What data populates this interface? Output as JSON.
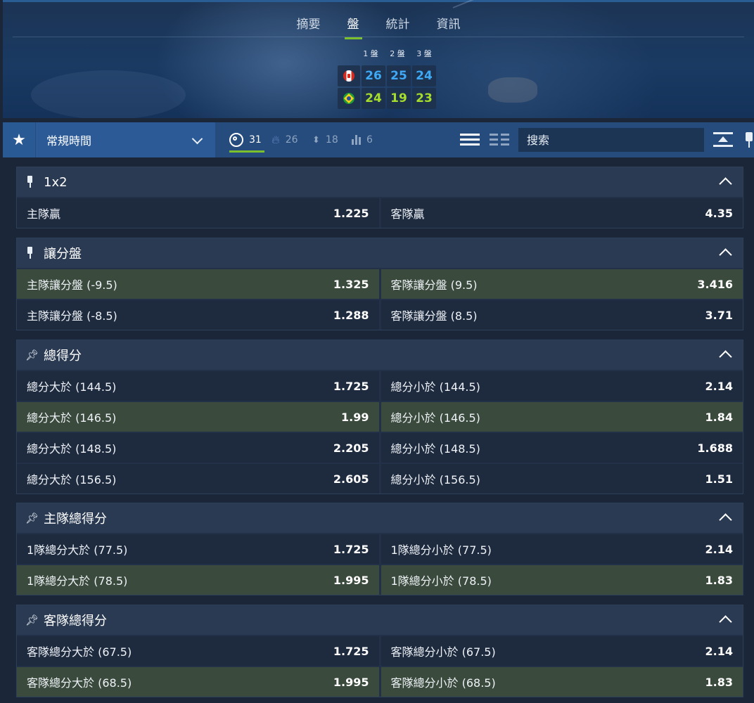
{
  "header": {
    "tabs": [
      {
        "label": "摘要"
      },
      {
        "label": "盤"
      },
      {
        "label": "統計"
      },
      {
        "label": "資訊"
      }
    ],
    "active_tab": "盤",
    "set_headers": [
      "1 盤",
      "2 盤",
      "3 盤"
    ],
    "teams": [
      {
        "flag": "canada-flag-icon",
        "scores": [
          "26",
          "25",
          "24"
        ],
        "color": "#3fa9f5"
      },
      {
        "flag": "brazil-flag-icon",
        "scores": [
          "24",
          "19",
          "23"
        ],
        "color": "#a6dc2c"
      }
    ]
  },
  "filter_bar": {
    "favorite_icon": "star-icon",
    "period_label": "常規時間",
    "filters": [
      {
        "icon": "target-icon",
        "count": "31",
        "active": true
      },
      {
        "icon": "fire-icon",
        "count": "26",
        "active": false
      },
      {
        "icon": "updown-arrows-icon",
        "count": "18",
        "active": false
      },
      {
        "icon": "bar-chart-icon",
        "count": "6",
        "active": false
      }
    ],
    "search_placeholder": "搜索"
  },
  "markets": [
    {
      "title": "1x2",
      "rows": [
        {
          "left_name": "主隊贏",
          "left_odds": "1.225",
          "right_name": "客隊贏",
          "right_odds": "4.35",
          "highlight": false
        }
      ]
    },
    {
      "title": "讓分盤",
      "rows": [
        {
          "left_name": "主隊讓分盤 (-9.5)",
          "left_odds": "1.325",
          "right_name": "客隊讓分盤 (9.5)",
          "right_odds": "3.416",
          "highlight": true
        },
        {
          "left_name": "主隊讓分盤 (-8.5)",
          "left_odds": "1.288",
          "right_name": "客隊讓分盤 (8.5)",
          "right_odds": "3.71",
          "highlight": false
        }
      ]
    },
    {
      "title": "總得分",
      "rows": [
        {
          "left_name": "總分大於 (144.5)",
          "left_odds": "1.725",
          "right_name": "總分小於 (144.5)",
          "right_odds": "2.14",
          "highlight": false
        },
        {
          "left_name": "總分大於 (146.5)",
          "left_odds": "1.99",
          "right_name": "總分小於 (146.5)",
          "right_odds": "1.84",
          "highlight": true
        },
        {
          "left_name": "總分大於 (148.5)",
          "left_odds": "2.205",
          "right_name": "總分小於 (148.5)",
          "right_odds": "1.688",
          "highlight": false
        },
        {
          "left_name": "總分大於 (156.5)",
          "left_odds": "2.605",
          "right_name": "總分小於 (156.5)",
          "right_odds": "1.51",
          "highlight": false
        }
      ]
    },
    {
      "title": "主隊總得分",
      "rows": [
        {
          "left_name": "1隊總分大於 (77.5)",
          "left_odds": "1.725",
          "right_name": "1隊總分小於 (77.5)",
          "right_odds": "2.14",
          "highlight": false
        },
        {
          "left_name": "1隊總分大於 (78.5)",
          "left_odds": "1.995",
          "right_name": "1隊總分小於 (78.5)",
          "right_odds": "1.83",
          "highlight": true
        }
      ]
    },
    {
      "title": "客隊總得分",
      "rows": [
        {
          "left_name": "客隊總分大於 (67.5)",
          "left_odds": "1.725",
          "right_name": "客隊總分小於 (67.5)",
          "right_odds": "2.14",
          "highlight": false
        },
        {
          "left_name": "客隊總分大於 (68.5)",
          "left_odds": "1.995",
          "right_name": "客隊總分小於 (68.5)",
          "right_odds": "1.83",
          "highlight": true
        }
      ]
    }
  ],
  "colors": {
    "accent": "#7cc12b",
    "home_score": "#3fa9f5",
    "away_score": "#a6dc2c",
    "highlight_row": "#3a4a3c"
  }
}
